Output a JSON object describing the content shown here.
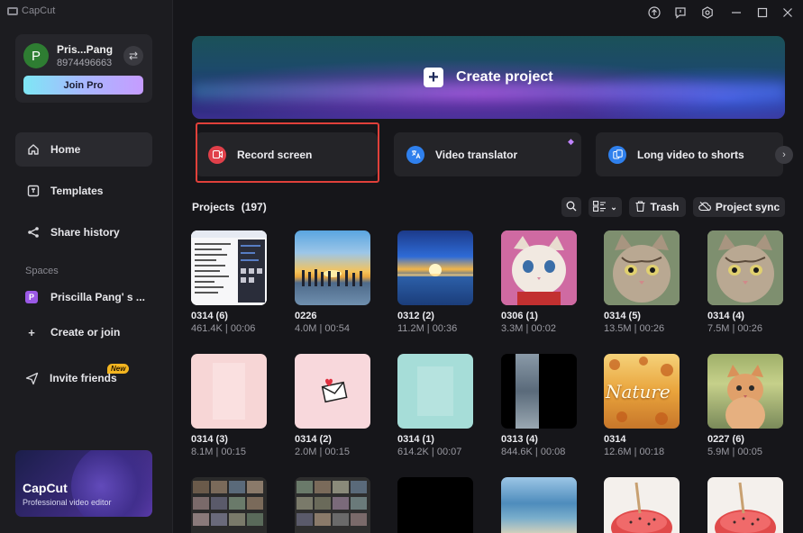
{
  "app": {
    "name": "CapCut"
  },
  "profile": {
    "initial": "P",
    "name": "Pris...Pang",
    "phone": "8974496663",
    "join_label": "Join Pro"
  },
  "nav": [
    {
      "label": "Home",
      "icon": "home-icon"
    },
    {
      "label": "Templates",
      "icon": "templates-icon"
    },
    {
      "label": "Share history",
      "icon": "share-icon"
    }
  ],
  "spaces": {
    "label": "Spaces",
    "space": {
      "initial": "P",
      "name": "Priscilla Pang' s ..."
    },
    "create_label": "Create or join"
  },
  "invite": {
    "label": "Invite friends",
    "badge": "New"
  },
  "promo": {
    "title": "CapCut",
    "subtitle": "Professional video editor"
  },
  "banner": {
    "label": "Create project"
  },
  "quick_actions": [
    {
      "label": "Record screen",
      "icon": "record-icon",
      "color": "#e0404a"
    },
    {
      "label": "Video translator",
      "icon": "translate-icon",
      "color": "#2f80ed"
    },
    {
      "label": "Long video to shorts",
      "icon": "shorts-icon",
      "color": "#2f80ed"
    }
  ],
  "projects": {
    "title": "Projects",
    "count": "(197)",
    "trash_label": "Trash",
    "sync_label": "Project sync"
  },
  "cards": [
    {
      "name": "0314 (6)",
      "meta": "461.4K | 00:06"
    },
    {
      "name": "0226",
      "meta": "4.0M | 00:54"
    },
    {
      "name": "0312 (2)",
      "meta": "11.2M | 00:36"
    },
    {
      "name": "0306 (1)",
      "meta": "3.3M | 00:02"
    },
    {
      "name": "0314 (5)",
      "meta": "13.5M | 00:26"
    },
    {
      "name": "0314 (4)",
      "meta": "7.5M | 00:26"
    },
    {
      "name": "0314 (3)",
      "meta": "8.1M | 00:15"
    },
    {
      "name": "0314 (2)",
      "meta": "2.0M | 00:15"
    },
    {
      "name": "0314 (1)",
      "meta": "614.2K | 00:07"
    },
    {
      "name": "0313 (4)",
      "meta": "844.6K | 00:08"
    },
    {
      "name": "0314",
      "meta": "12.6M | 00:18",
      "overlay": "Nature"
    },
    {
      "name": "0227 (6)",
      "meta": "5.9M | 00:05"
    }
  ]
}
